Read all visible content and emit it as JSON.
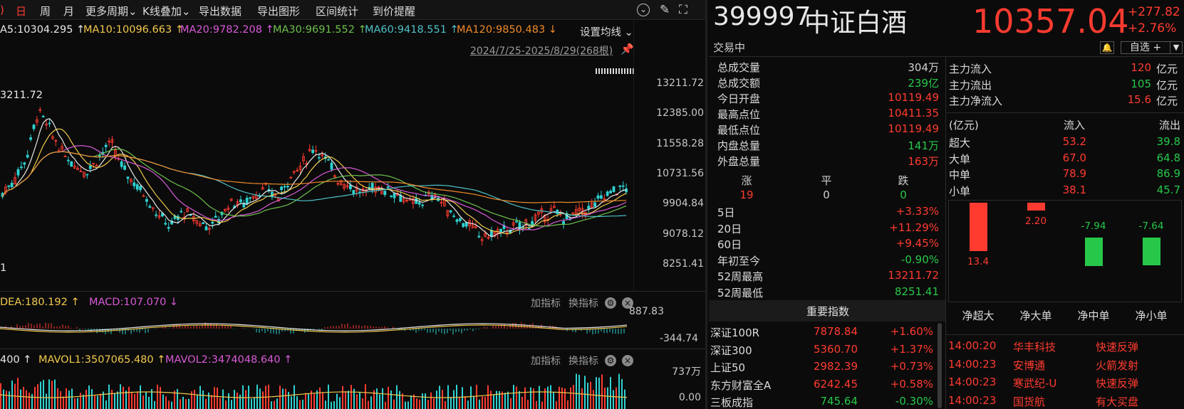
{
  "toolbar": {
    "items": [
      "日",
      "周",
      "月",
      "更多周期",
      "K线叠加",
      "导出数据",
      "导出图形",
      "区间统计",
      "到价提醒"
    ],
    "edge": ")",
    "chevron": "⌄"
  },
  "ma": {
    "ma5": "A5:10304.295 ↑",
    "ma10": "MA10:10096.663 ↑",
    "ma20": "MA20:9782.208 ↑",
    "ma30": "MA30:9691.552 ↑",
    "ma60": "MA60:9418.551 ↑",
    "ma120": "MA120:9850.483 ↓",
    "settings": "设置均线 ⌄"
  },
  "range_label": "2024/7/25-2025/8/29(268根)",
  "chart": {
    "high_marker": "3211.72",
    "low_marker": "1",
    "y_labels": [
      "13211.72",
      "12385.00",
      "11558.28",
      "10731.56",
      "9904.84",
      "9078.12",
      "8251.41"
    ],
    "macd": {
      "dea": "DEA:180.192 ↑",
      "macd": "MACD:107.070 ↓",
      "y_top": "887.83",
      "y_bottom": "-344.74",
      "add": "加指标",
      "swap": "换指标"
    },
    "vol": {
      "edge": "400 ↑",
      "mavol1": "MAVOL1:3507065.480 ↑",
      "mavol2": "MAVOL2:3474048.640 ↑",
      "y_top": "737万",
      "y_bottom": "0.00",
      "add": "加指标",
      "swap": "换指标"
    }
  },
  "chart_data": {
    "type": "candlestick",
    "title": "399997 中证白酒",
    "range": "2024/7/25-2025/8/29(268根)",
    "ylim": [
      8251.41,
      13211.72
    ],
    "y_ticks": [
      13211.72,
      12385.0,
      11558.28,
      10731.56,
      9904.84,
      9078.12,
      8251.41
    ],
    "series": [
      {
        "name": "MA5",
        "value": 10304.295
      },
      {
        "name": "MA10",
        "value": 10096.663
      },
      {
        "name": "MA20",
        "value": 9782.208
      },
      {
        "name": "MA30",
        "value": 9691.552
      },
      {
        "name": "MA60",
        "value": 9418.551
      },
      {
        "name": "MA120",
        "value": 9850.483
      }
    ],
    "price_path": [
      10200,
      10600,
      11200,
      12500,
      11900,
      11300,
      11000,
      10800,
      11200,
      11600,
      10900,
      10500,
      10100,
      9600,
      9300,
      9700,
      9500,
      9300,
      9500,
      10000,
      9900,
      10200,
      10300,
      10100,
      10700,
      11000,
      11500,
      11100,
      10600,
      10400,
      10200,
      10400,
      10300,
      10200,
      9900,
      10000,
      10200,
      9800,
      9500,
      9300,
      9000,
      9100,
      9200,
      9300,
      9400,
      9600,
      9700,
      9500,
      9700,
      9800,
      10100,
      10300,
      10357
    ]
  },
  "header": {
    "code": "399997",
    "name": "中证白酒",
    "price": "10357.04",
    "change": "+277.82",
    "change_pct": "+2.76%",
    "status": "交易中",
    "watch": "自选 +",
    "colors": {
      "up": "#ff3b30",
      "down": "#27c84a"
    }
  },
  "stats": [
    {
      "label": "总成交量",
      "value": "304万"
    },
    {
      "label": "总成交额",
      "value": "239亿"
    },
    {
      "label": "今日开盘",
      "value": "10119.49"
    },
    {
      "label": "最高点位",
      "value": "10411.35"
    },
    {
      "label": "最低点位",
      "value": "10119.49"
    },
    {
      "label": "内盘总量",
      "value": "141万"
    },
    {
      "label": "外盘总量",
      "value": "163万"
    }
  ],
  "breadth": {
    "up_label": "涨",
    "flat_label": "平",
    "down_label": "跌",
    "up": "19",
    "flat": "0",
    "down": "0"
  },
  "perf": [
    {
      "label": "5日",
      "value": "+3.33%"
    },
    {
      "label": "20日",
      "value": "+11.29%"
    },
    {
      "label": "60日",
      "value": "+9.45%"
    },
    {
      "label": "年初至今",
      "value": "-0.90%"
    },
    {
      "label": "52周最高",
      "value": "13211.72"
    },
    {
      "label": "52周最低",
      "value": "8251.41"
    }
  ],
  "indices": {
    "title": "重要指数",
    "rows": [
      {
        "name": "深证100R",
        "value": "7878.84",
        "pct": "+1.60%"
      },
      {
        "name": "深证300",
        "value": "5360.70",
        "pct": "+1.37%"
      },
      {
        "name": "上证50",
        "value": "2982.39",
        "pct": "+0.73%"
      },
      {
        "name": "东方财富全A",
        "value": "6242.45",
        "pct": "+0.58%"
      },
      {
        "name": "三板成指",
        "value": "745.64",
        "pct": "-0.30%"
      }
    ]
  },
  "flow": {
    "in_label": "主力流入",
    "in_value": "120",
    "in_unit": "亿元",
    "out_label": "主力流出",
    "out_value": "105",
    "out_unit": "亿元",
    "net_label": "主力净流入",
    "net_value": "15.6",
    "net_unit": "亿元",
    "table_head": [
      "(亿元)",
      "流入",
      "流出"
    ],
    "rows": [
      {
        "label": "超大",
        "in": "53.2",
        "out": "39.8"
      },
      {
        "label": "大单",
        "in": "67.0",
        "out": "64.8"
      },
      {
        "label": "中单",
        "in": "78.9",
        "out": "86.9"
      },
      {
        "label": "小单",
        "in": "38.1",
        "out": "45.7"
      }
    ],
    "net_bars": [
      {
        "label": "净超大",
        "value": 13.4,
        "text": "13.4"
      },
      {
        "label": "净大单",
        "value": 2.2,
        "text": "2.20"
      },
      {
        "label": "净中单",
        "value": -7.94,
        "text": "-7.94"
      },
      {
        "label": "净小单",
        "value": -7.64,
        "text": "-7.64"
      }
    ]
  },
  "ticks": [
    {
      "time": "14:00:20",
      "name": "华丰科技",
      "event": "快速反弹"
    },
    {
      "time": "14:00:23",
      "name": "安博通",
      "event": "火箭发射"
    },
    {
      "time": "14:00:23",
      "name": "寒武纪-U",
      "event": "快速反弹"
    },
    {
      "time": "14:00:23",
      "name": "国货航",
      "event": "有大买盘"
    }
  ]
}
